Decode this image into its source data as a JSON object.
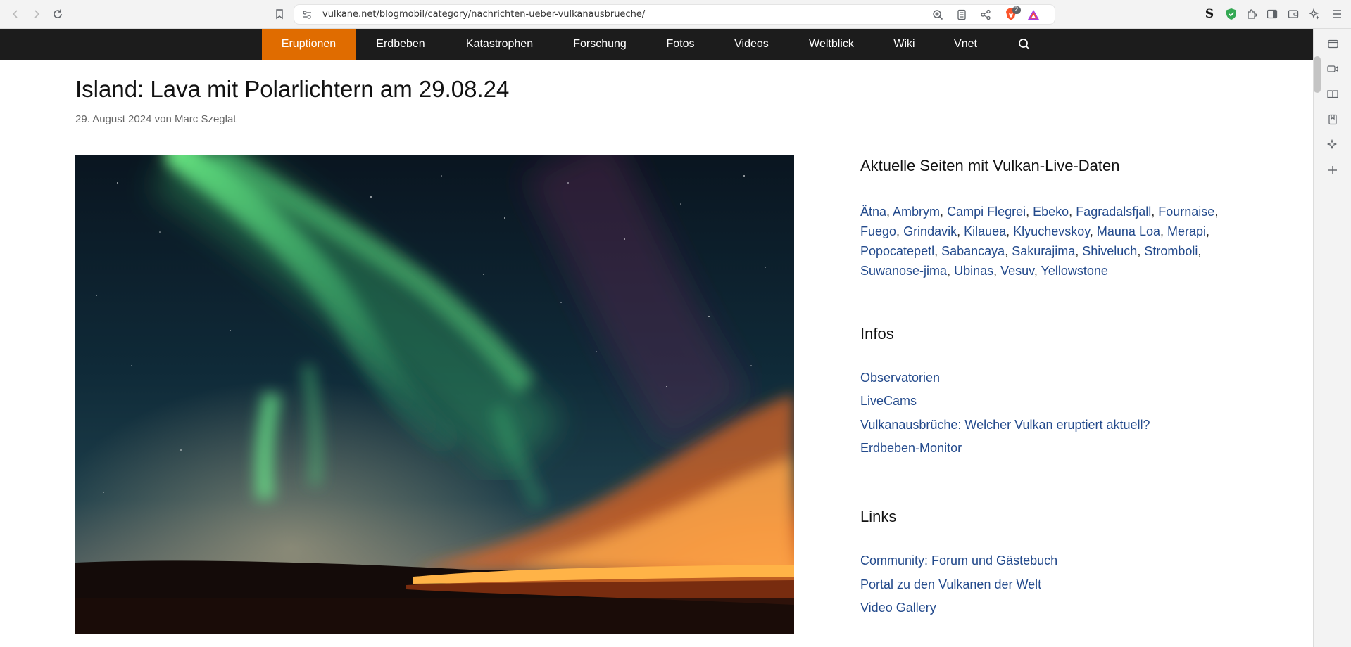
{
  "browser": {
    "url": "vulkane.net/blogmobil/category/nachrichten-ueber-vulkanausbrueche/",
    "icons": [
      "back-icon",
      "forward-icon",
      "reload-icon",
      "bookmark-icon",
      "site-info-icon",
      "zoom-icon",
      "reader-icon",
      "share-icon",
      "brave-shields-icon",
      "brave-rewards-icon",
      "extension-s-icon",
      "shield-check-icon",
      "extensions-icon",
      "sidebar-icon",
      "wallet-icon",
      "leo-icon",
      "menu-icon"
    ],
    "shields_badge": "2"
  },
  "nav": {
    "items": [
      "Eruptionen",
      "Erdbeben",
      "Katastrophen",
      "Forschung",
      "Fotos",
      "Videos",
      "Weltblick",
      "Wiki",
      "Vnet"
    ],
    "active_index": 0,
    "search_icon": "search-icon"
  },
  "article": {
    "title": "Island: Lava mit Polarlichtern am 29.08.24",
    "meta": "29. August 2024 von Marc Szeglat"
  },
  "sidebar": {
    "live_heading": "Aktuelle Seiten mit Vulkan-Live-Daten",
    "volcanoes": [
      "Ätna",
      "Ambrym",
      "Campi Flegrei",
      "Ebeko",
      "Fagradalsfjall",
      "Fournaise",
      "Fuego",
      "Grindavik",
      "Kilauea",
      "Klyuchevskoy",
      "Mauna Loa",
      "Merapi",
      "Popocatepetl",
      "Sabancaya",
      "Sakurajima",
      "Shiveluch",
      "Stromboli",
      "Suwanose-jima",
      "Ubinas",
      "Vesuv",
      "Yellowstone"
    ],
    "infos_heading": "Infos",
    "infos": [
      "Observatorien",
      "LiveCams",
      "Vulkanausbrüche: Welcher Vulkan eruptiert aktuell?",
      "Erdbeben-Monitor"
    ],
    "links_heading": "Links",
    "links": [
      "Community: Forum und Gästebuch",
      "Portal zu den Vulkanen der Welt",
      "Video Gallery"
    ]
  },
  "colors": {
    "nav_bg": "#1c1c1c",
    "nav_active": "#e06c00",
    "link": "#234a8c"
  }
}
